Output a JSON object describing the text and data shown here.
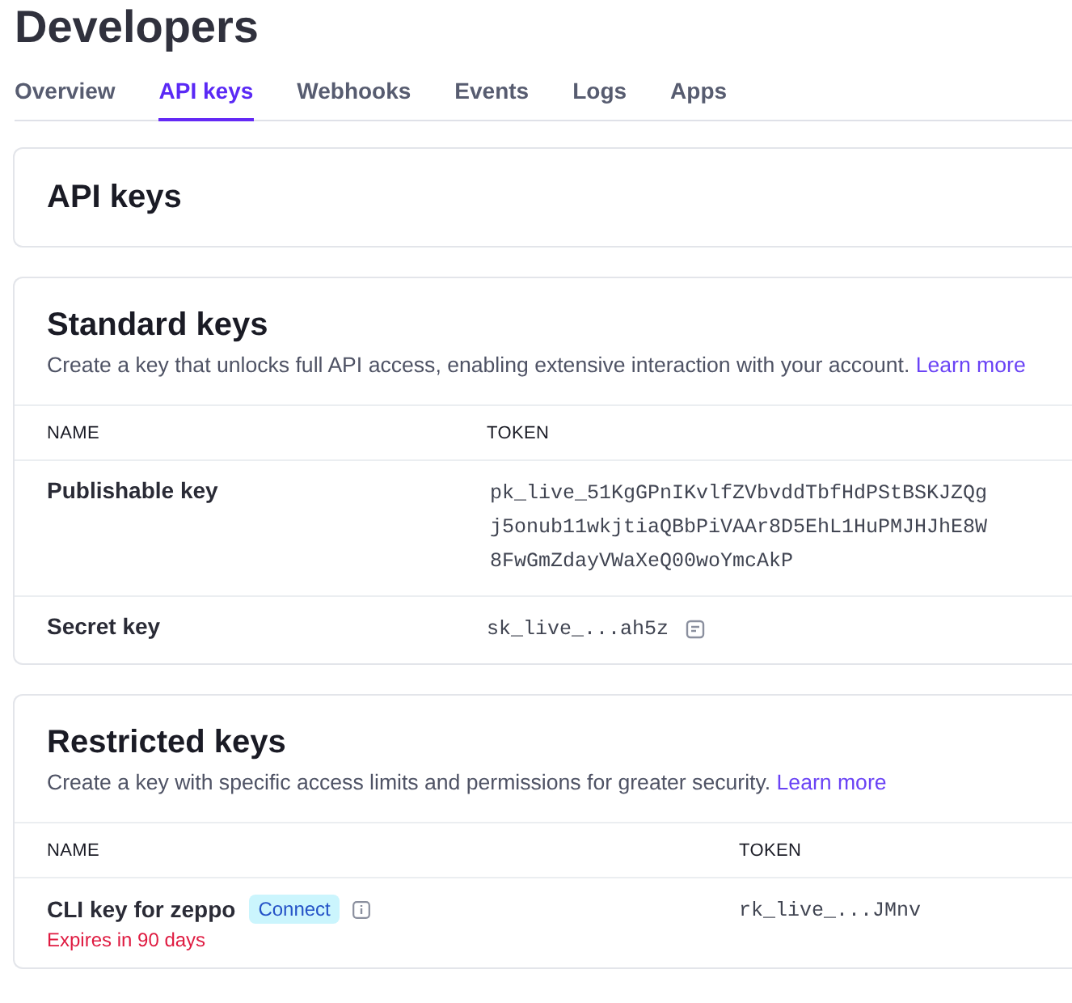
{
  "page": {
    "title": "Developers"
  },
  "tabs": [
    {
      "label": "Overview",
      "selected": false
    },
    {
      "label": "API keys",
      "selected": true
    },
    {
      "label": "Webhooks",
      "selected": false
    },
    {
      "label": "Events",
      "selected": false
    },
    {
      "label": "Logs",
      "selected": false
    },
    {
      "label": "Apps",
      "selected": false
    }
  ],
  "header_card": {
    "title": "API keys"
  },
  "sections": [
    {
      "title": "Standard keys",
      "description": "Create a key that unlocks full API access, enabling extensive interaction with your account.",
      "link": "Learn more",
      "columns": [
        "NAME",
        "TOKEN"
      ],
      "rows": [
        {
          "name": "Publishable key",
          "token": "pk_live_51KgGPnIKvlfZVbvddTbfHdPStBSKJZQgj5onub11wkjtiaQBbPiVAAr8D5EhL1HuPMJHJhE8W8FwGmZdayVWaXeQ00woYmcAkP",
          "copy": false
        },
        {
          "name": "Secret key",
          "token": "sk_live_...ah5z",
          "copy": true
        }
      ]
    },
    {
      "title": "Restricted keys",
      "description": "Create a key with specific access limits and permissions for greater security.",
      "link": "Learn more",
      "columns": [
        "NAME",
        "TOKEN"
      ],
      "rows": [
        {
          "name": "CLI key for zeppo",
          "badge": "Connect",
          "info": true,
          "note": "Expires in 90 days",
          "token": "rk_live_...JMnv",
          "copy": false
        }
      ]
    }
  ]
}
